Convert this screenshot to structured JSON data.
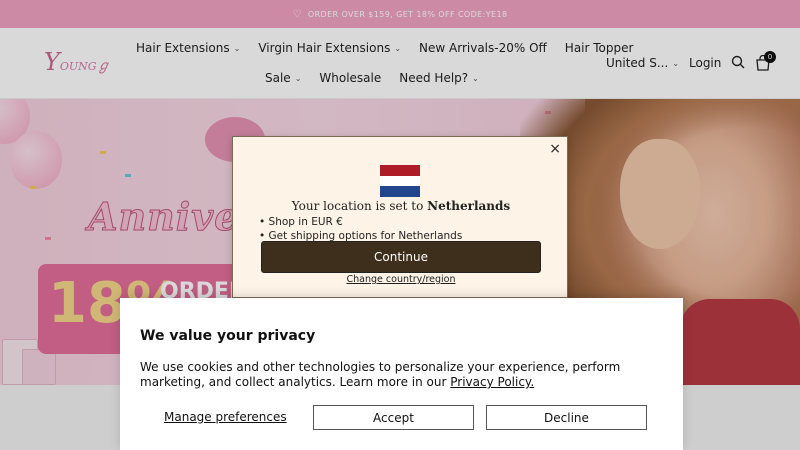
{
  "announcement": {
    "icon": "heart-icon",
    "text": "ORDER OVER $159, GET 18% OFF CODE:YE18"
  },
  "header": {
    "logo_text": "Young",
    "nav_row1": [
      {
        "label": "Hair Extensions",
        "has_dropdown": true
      },
      {
        "label": "Virgin Hair Extensions",
        "has_dropdown": true
      },
      {
        "label": "New Arrivals-20% Off",
        "has_dropdown": false
      },
      {
        "label": "Hair Topper",
        "has_dropdown": false
      }
    ],
    "nav_row2": [
      {
        "label": "Sale",
        "has_dropdown": true
      },
      {
        "label": "Wholesale",
        "has_dropdown": false
      },
      {
        "label": "Need Help?",
        "has_dropdown": true
      }
    ],
    "country": "United S...",
    "login": "Login",
    "cart_count": "0"
  },
  "hero": {
    "anniversary_text": "Anniver",
    "discount_text": "18%",
    "order_text": "ORDER"
  },
  "location_modal": {
    "close_label": "×",
    "title_prefix": "Your location is set to",
    "country": "Netherlands",
    "bullets": [
      "Shop in EUR €",
      "Get shipping options for Netherlands"
    ],
    "continue_label": "Continue",
    "change_label": "Change country/region",
    "flag_colors": [
      "#ae1c28",
      "#ffffff",
      "#21468b"
    ]
  },
  "privacy": {
    "title": "We value your privacy",
    "text": "We use cookies and other technologies to personalize your experience, perform marketing, and collect analytics. Learn more in our ",
    "policy_link": "Privacy Policy.",
    "manage_label": "Manage preferences",
    "accept_label": "Accept",
    "decline_label": "Decline"
  }
}
